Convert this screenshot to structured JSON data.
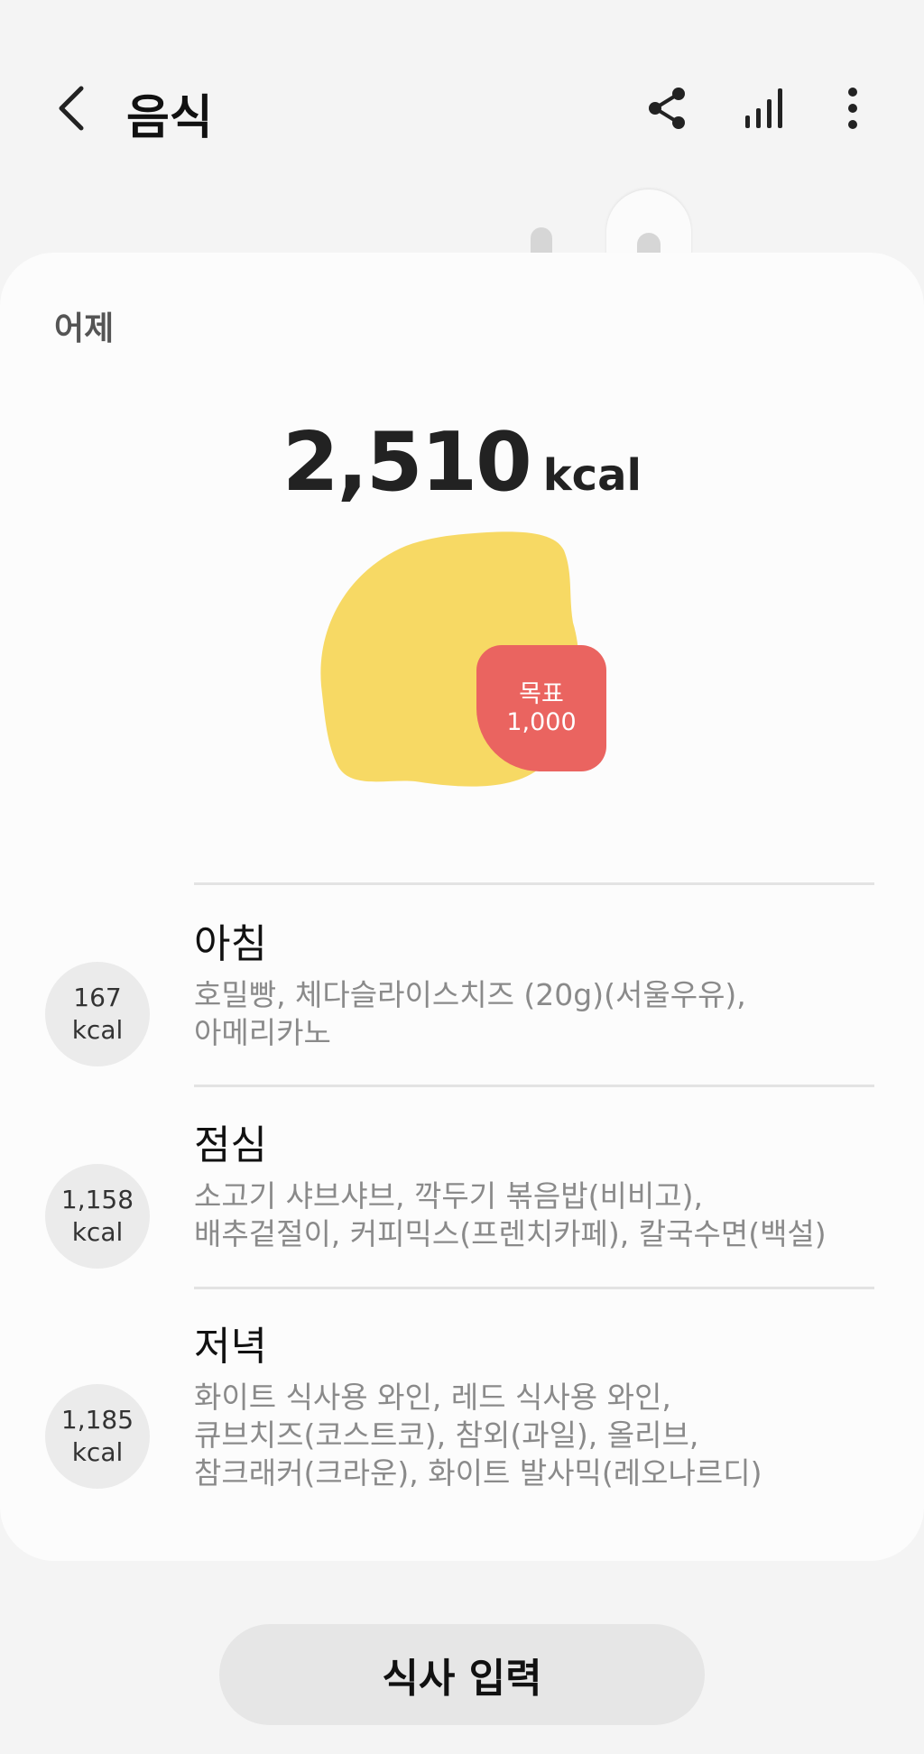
{
  "header": {
    "title": "음식",
    "back_icon": "chevron-left-icon",
    "share_icon": "share-icon",
    "stats_icon": "bar-chart-icon",
    "more_icon": "more-vert-icon"
  },
  "summary": {
    "day_label": "어제",
    "total_kcal": "2,510",
    "kcal_unit": "kcal",
    "goal_label": "목표",
    "goal_value": "1,000",
    "colors": {
      "intake": "#F7D964",
      "goal": "#EA6460"
    }
  },
  "meals": [
    {
      "name": "아침",
      "kcal": "167",
      "unit": "kcal",
      "items_line1": "호밀빵, 체다슬라이스치즈 (20g)(서울우유),",
      "items_line2": "아메리카노",
      "items_line3": ""
    },
    {
      "name": "점심",
      "kcal": "1,158",
      "unit": "kcal",
      "items_line1": "소고기 샤브샤브, 깍두기 볶음밥(비비고),",
      "items_line2": "배추겉절이, 커피믹스(프렌치카페), 칼국수면(백설)",
      "items_line3": ""
    },
    {
      "name": "저녁",
      "kcal": "1,185",
      "unit": "kcal",
      "items_line1": "화이트 식사용 와인, 레드 식사용 와인,",
      "items_line2": "큐브치즈(코스트코), 참외(과일), 올리브,",
      "items_line3": "참크래커(크라운), 화이트 발사믹(레오나르디)"
    }
  ],
  "actions": {
    "add_meal_label": "식사 입력"
  }
}
